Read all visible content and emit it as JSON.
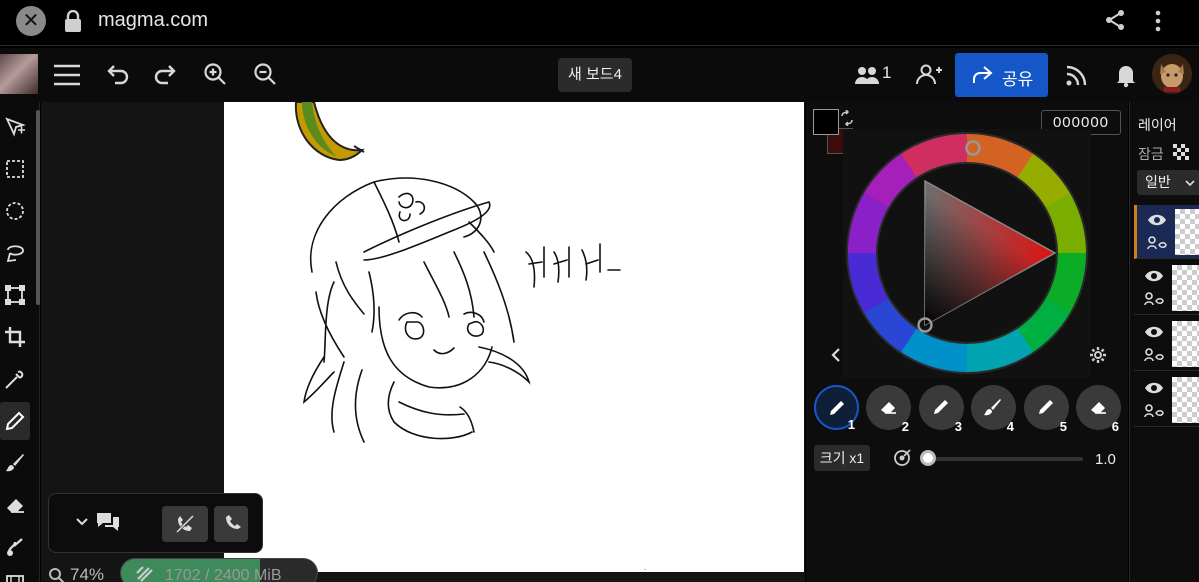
{
  "browser": {
    "url": "magma.com"
  },
  "toolbar": {
    "board_name": "새 보드4",
    "users_count": "1",
    "share_label": "공유"
  },
  "color": {
    "hex": "000000",
    "foreground": "#000000",
    "background": "#3a0c0c"
  },
  "brushes": [
    {
      "num": "1",
      "icon": "pen-icon"
    },
    {
      "num": "2",
      "icon": "eraser-icon"
    },
    {
      "num": "3",
      "icon": "pen-icon"
    },
    {
      "num": "4",
      "icon": "brush-icon"
    },
    {
      "num": "5",
      "icon": "pen-icon"
    },
    {
      "num": "6",
      "icon": "eraser-icon"
    }
  ],
  "brush_size": {
    "label": "크기 x1",
    "value": "1.0"
  },
  "layers": {
    "title": "레이어",
    "lock_label": "잠금",
    "blend_mode": "일반"
  },
  "status": {
    "zoom": "74%",
    "progress_text": "1702 / 2400 MiB",
    "progress_fraction": 0.71
  },
  "canvas": {
    "handwriting": "케케케_"
  },
  "accent": "#1557c8"
}
